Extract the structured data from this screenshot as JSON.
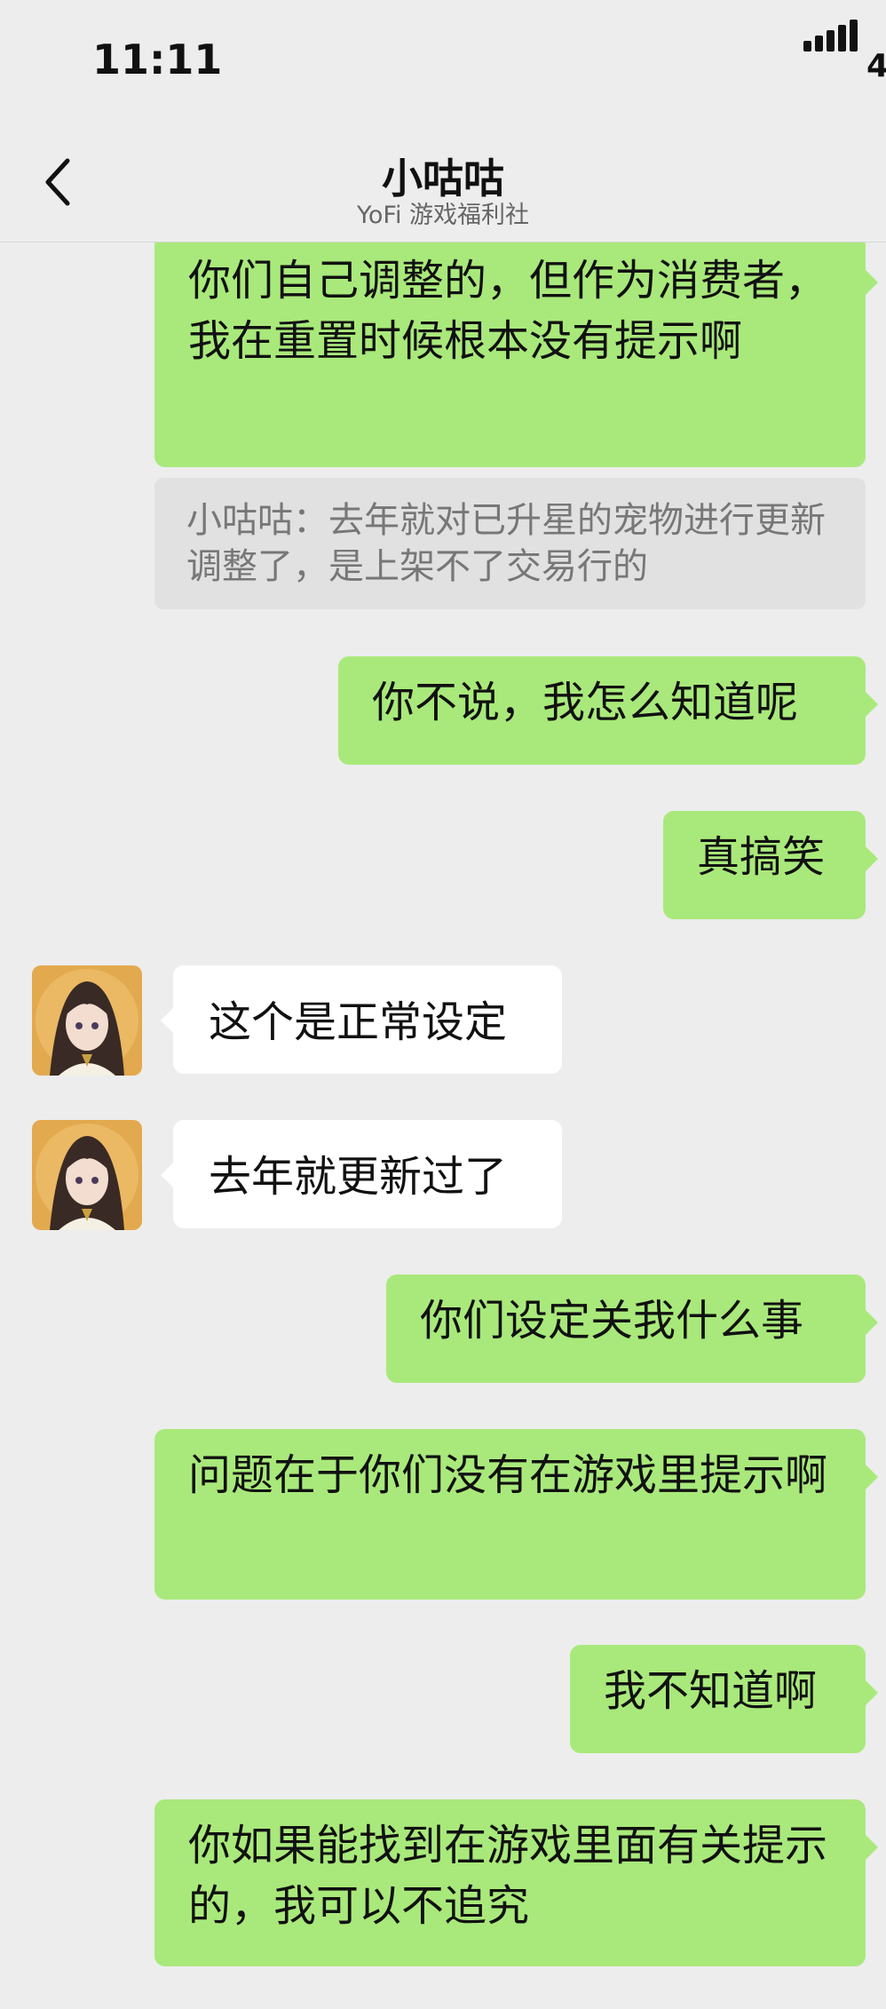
{
  "status": {
    "time": "11:11",
    "network": "4"
  },
  "header": {
    "title": "小咕咕",
    "subtitle": "YoFi 游戏福利社"
  },
  "messages": [
    {
      "side": "right",
      "text": "你们自己调整的，但作为消费者，我在重置时候根本没有提示啊"
    },
    {
      "side": "quote",
      "text": "小咕咕：去年就对已升星的宠物进行更新调整了，是上架不了交易行的"
    },
    {
      "side": "right",
      "text": "你不说，我怎么知道呢"
    },
    {
      "side": "right",
      "text": "真搞笑"
    },
    {
      "side": "left",
      "text": "这个是正常设定"
    },
    {
      "side": "left",
      "text": "去年就更新过了"
    },
    {
      "side": "right",
      "text": "你们设定关我什么事"
    },
    {
      "side": "right",
      "text": "问题在于你们没有在游戏里提示啊"
    },
    {
      "side": "right",
      "text": "我不知道啊"
    },
    {
      "side": "right",
      "text": "你如果能找到在游戏里面有关提示的，我可以不追究"
    }
  ],
  "colors": {
    "sent_bubble": "#a9e97b",
    "received_bubble": "#ffffff",
    "background": "#ededed"
  },
  "icons": {
    "back": "chevron-left-icon",
    "signal": "signal-icon",
    "avatar": "anime-avatar"
  }
}
